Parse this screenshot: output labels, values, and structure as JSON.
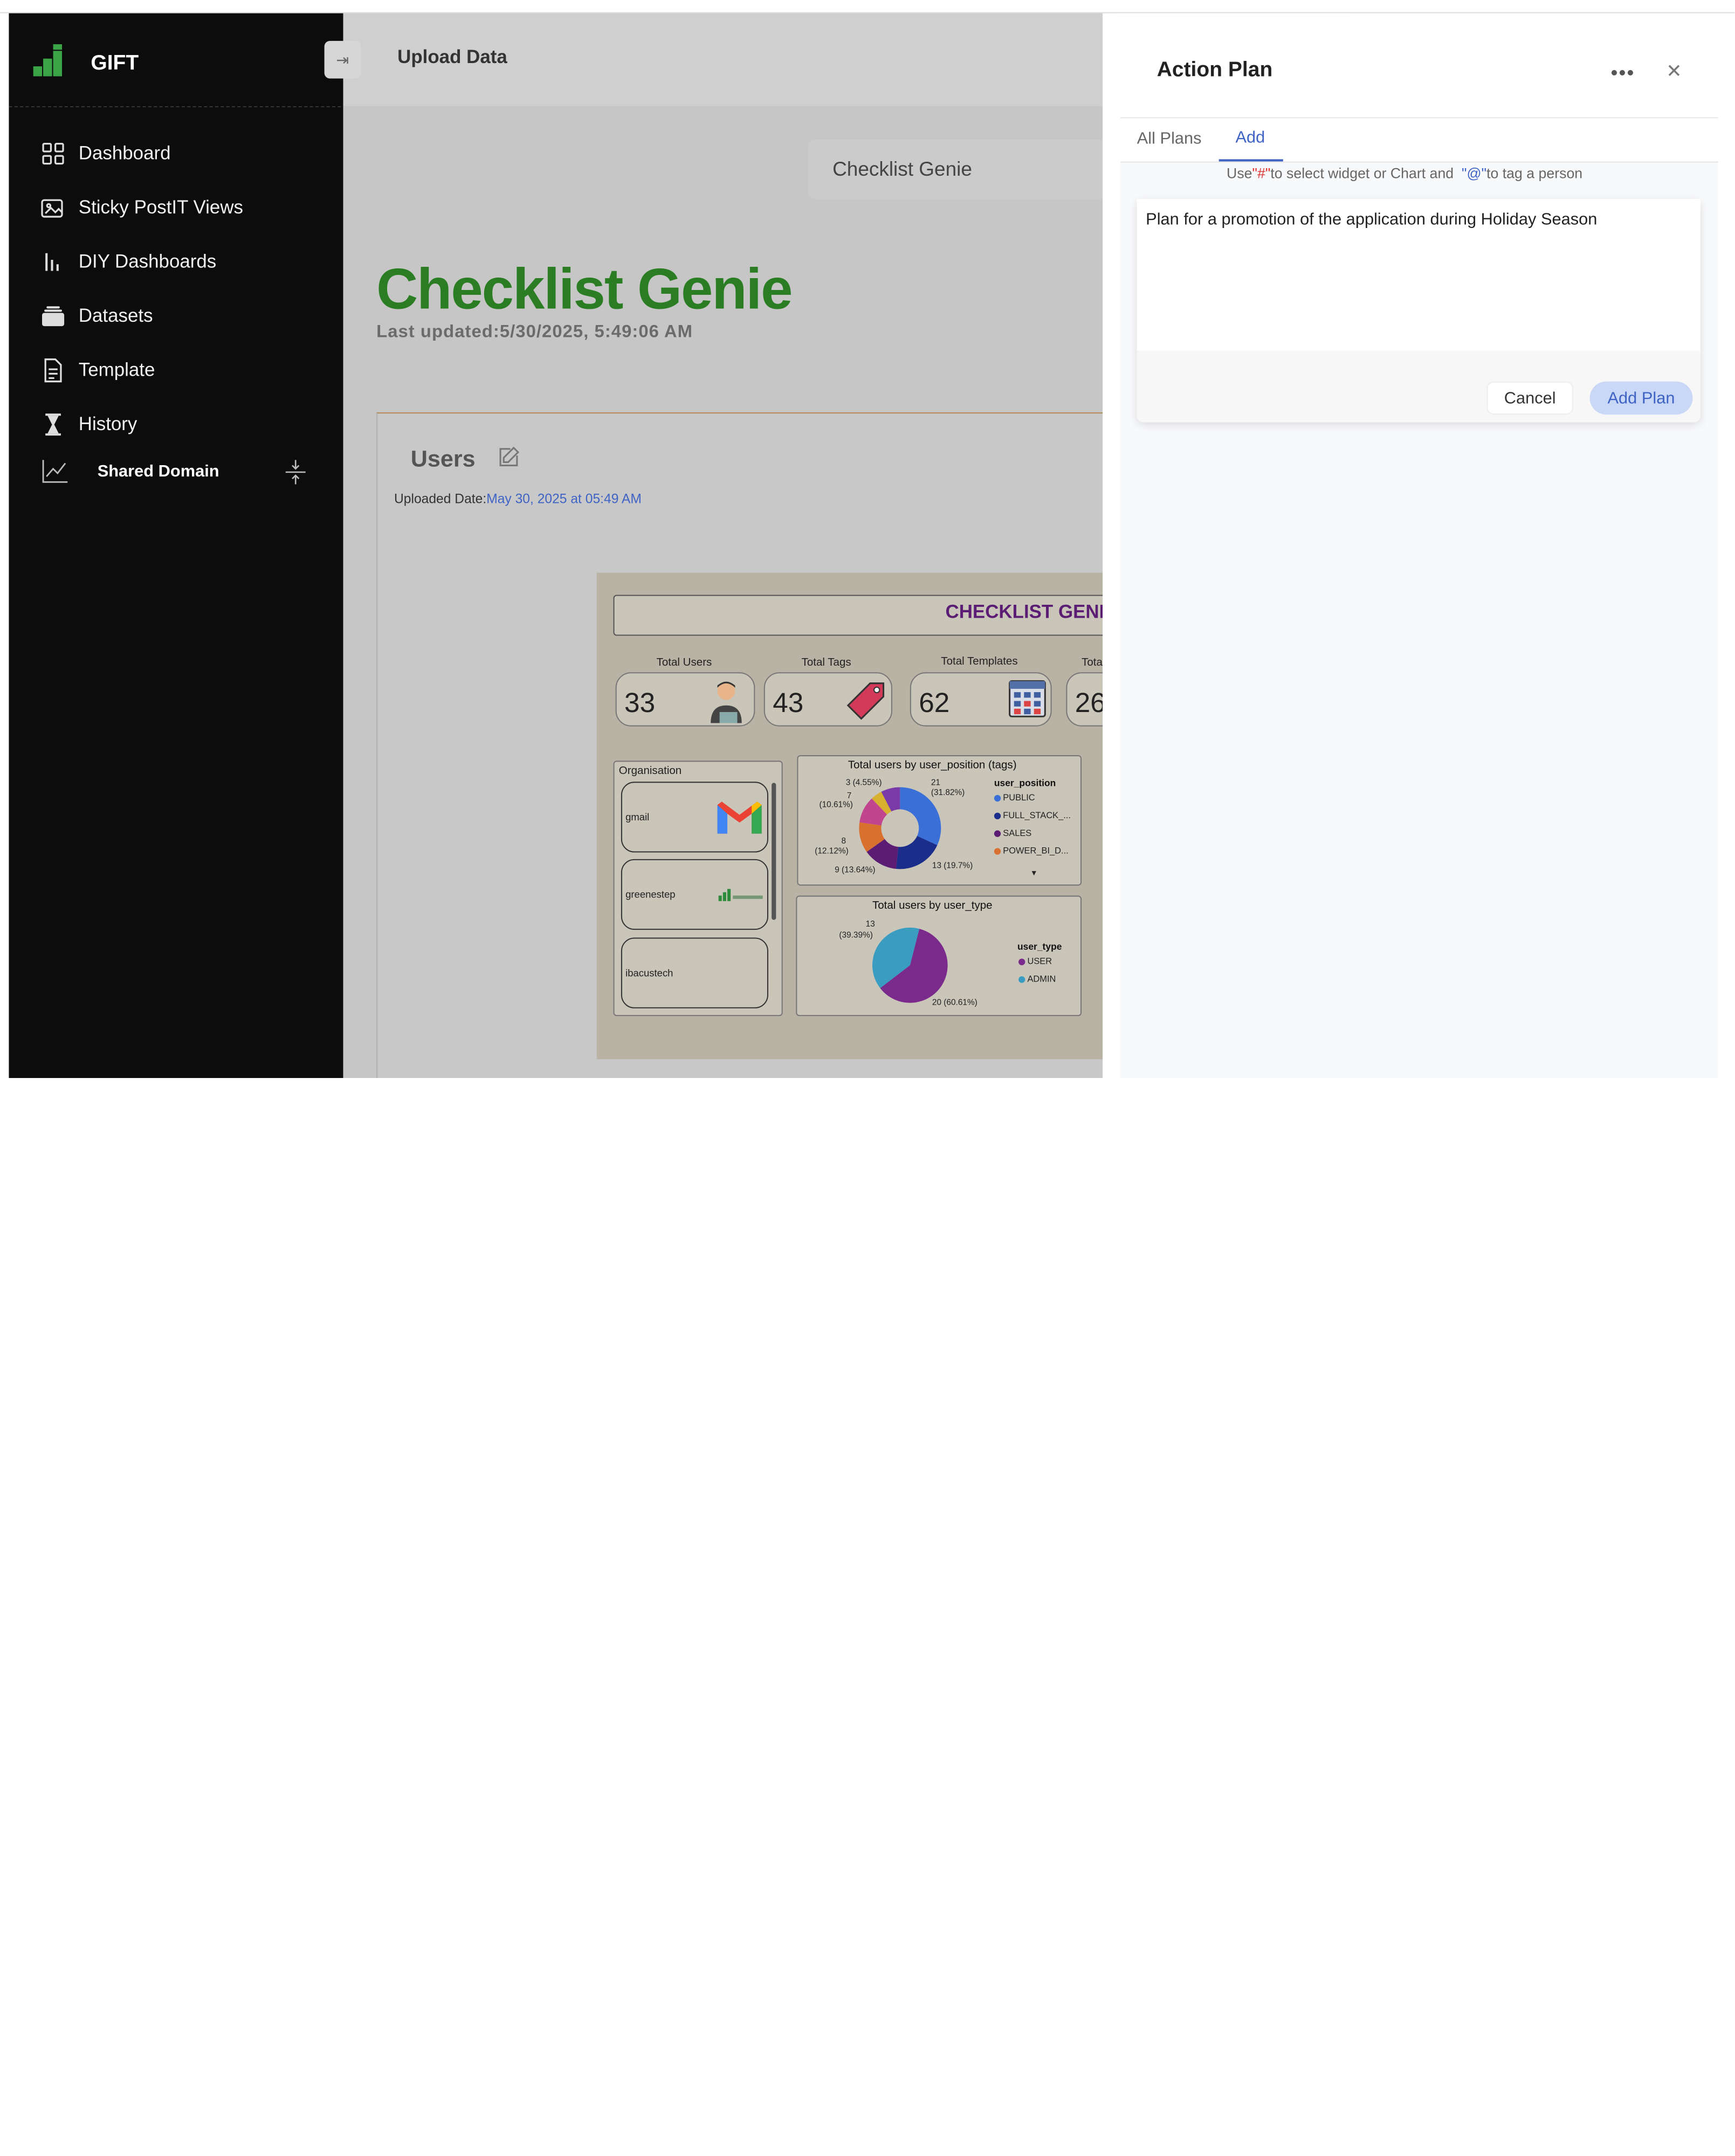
{
  "sidebar": {
    "brand": "GIFT",
    "items": [
      {
        "label": "Dashboard",
        "icon": "grid-icon"
      },
      {
        "label": "Sticky PostIT Views",
        "icon": "image-icon"
      },
      {
        "label": "DIY Dashboards",
        "icon": "bar-chart-icon"
      },
      {
        "label": "Datasets",
        "icon": "folder-icon"
      },
      {
        "label": "Template",
        "icon": "document-icon"
      },
      {
        "label": "History",
        "icon": "hourglass-icon"
      }
    ],
    "shared_domain": "Shared Domain"
  },
  "header": {
    "upload_label": "Upload Data",
    "selector_value": "Checklist Genie"
  },
  "main": {
    "title": "Checklist Genie",
    "last_updated": "Last updated:5/30/2025, 5:49:06 AM",
    "card": {
      "title": "Users",
      "uploaded_label": "Uploaded Date:",
      "uploaded_value": "May 30, 2025 at 05:49 AM"
    },
    "dashboard": {
      "banner": "CHECKLIST GENIE",
      "kpis": [
        {
          "label": "Total Users",
          "value": "33"
        },
        {
          "label": "Total Tags",
          "value": "43"
        },
        {
          "label": "Total Templates",
          "value": "62"
        },
        {
          "label": "Tota",
          "value": "26"
        }
      ],
      "org_title": "Organisation",
      "orgs": [
        "gmail",
        "greenestep",
        "ibacustech"
      ],
      "chart1_title": "Total users by user_position (tags)",
      "chart1_legend_title": "user_position",
      "chart1_legend": [
        "PUBLIC",
        "FULL_STACK_...",
        "SALES",
        "POWER_BI_D..."
      ],
      "chart1_labels": [
        "3 (4.55%)",
        "21",
        "(31.82%)",
        "7",
        "(10.61%)",
        "8",
        "(12.12%)",
        "9 (13.64%)",
        "13 (19.7%)"
      ],
      "chart2_title": "Total users by user_type",
      "chart2_legend_title": "user_type",
      "chart2_legend": [
        "USER",
        "ADMIN"
      ],
      "chart2_labels": [
        "13",
        "(39.39%)",
        "20 (60.61%)"
      ]
    }
  },
  "action_plan": {
    "title": "Action Plan",
    "tabs": [
      "All Plans",
      "Add"
    ],
    "hint_1": "Use",
    "hint_hash": "\"#\"",
    "hint_2": "to select widget or Chart and",
    "hint_at": "\"@\"",
    "hint_3": "to tag a person",
    "text_value": "Plan for a promotion of the application during Holiday Season",
    "cancel": "Cancel",
    "add_plan": "Add Plan"
  },
  "colors": {
    "accent": "#3e63c4",
    "title_green": "#2b7d24",
    "sidebar_bg": "#0c0c0d"
  }
}
